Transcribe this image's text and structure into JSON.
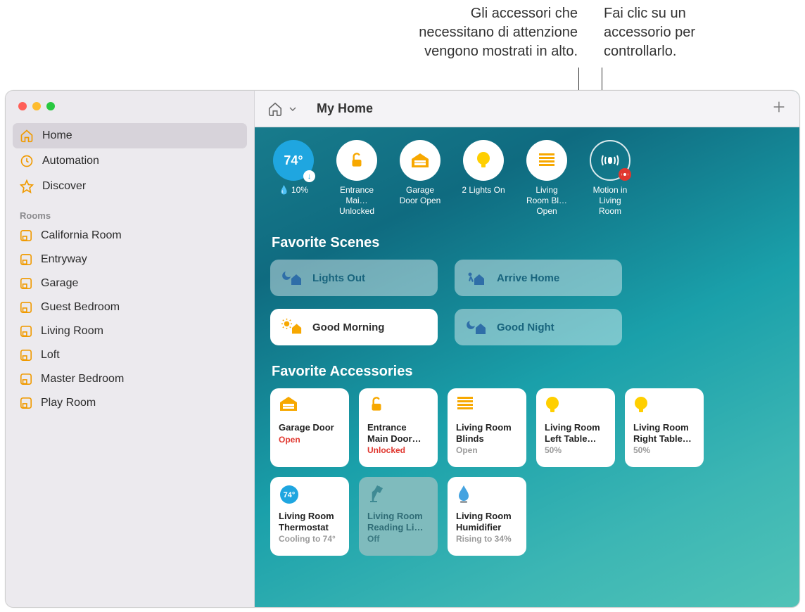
{
  "callouts": {
    "attention": "Gli accessori che necessitano di attenzione vengono mostrati in alto.",
    "click": "Fai clic su un accessorio per controllarlo."
  },
  "sidebar": {
    "items": [
      {
        "label": "Home",
        "icon": "home"
      },
      {
        "label": "Automation",
        "icon": "clock"
      },
      {
        "label": "Discover",
        "icon": "star"
      }
    ],
    "section_label": "Rooms",
    "rooms": [
      "California Room",
      "Entryway",
      "Garage",
      "Guest Bedroom",
      "Living Room",
      "Loft",
      "Master Bedroom",
      "Play Room"
    ]
  },
  "topbar": {
    "title": "My Home"
  },
  "status": {
    "weather": {
      "temp": "74°",
      "humidity": "10%"
    },
    "tiles": [
      {
        "label": "Entrance Mai… Unlocked",
        "icon": "lock-open"
      },
      {
        "label": "Garage Door Open",
        "icon": "garage"
      },
      {
        "label": "2 Lights On",
        "icon": "bulb"
      },
      {
        "label": "Living Room Bl… Open",
        "icon": "blinds"
      },
      {
        "label": "Motion in Living Room",
        "icon": "motion",
        "ring": true,
        "badge": true
      }
    ]
  },
  "scenes": {
    "title": "Favorite Scenes",
    "items": [
      {
        "label": "Lights Out",
        "icon": "moon-house",
        "active": false
      },
      {
        "label": "Arrive Home",
        "icon": "walk-house",
        "active": false
      },
      {
        "label": "Good Morning",
        "icon": "sun-house",
        "active": true
      },
      {
        "label": "Good Night",
        "icon": "moon-house",
        "active": false
      }
    ]
  },
  "accessories": {
    "title": "Favorite Accessories",
    "items": [
      {
        "name": "Garage Door",
        "state": "Open",
        "state_class": "alert",
        "icon": "garage",
        "off": false
      },
      {
        "name": "Entrance Main Door…",
        "state": "Unlocked",
        "state_class": "alert",
        "icon": "lock-open",
        "off": false
      },
      {
        "name": "Living Room Blinds",
        "state": "Open",
        "state_class": "gray",
        "icon": "blinds",
        "off": false
      },
      {
        "name": "Living Room Left Table…",
        "state": "50%",
        "state_class": "gray",
        "icon": "bulb",
        "off": false
      },
      {
        "name": "Living Room Right Table…",
        "state": "50%",
        "state_class": "gray",
        "icon": "bulb",
        "off": false
      },
      {
        "name": "Living Room Thermostat",
        "state": "Cooling to 74°",
        "state_class": "gray",
        "icon": "thermo",
        "off": false
      },
      {
        "name": "Living Room Reading Li…",
        "state": "Off",
        "state_class": "teal",
        "icon": "lamp",
        "off": true
      },
      {
        "name": "Living Room Humidifier",
        "state": "Rising to 34%",
        "state_class": "gray",
        "icon": "humidifier",
        "off": false
      }
    ]
  }
}
